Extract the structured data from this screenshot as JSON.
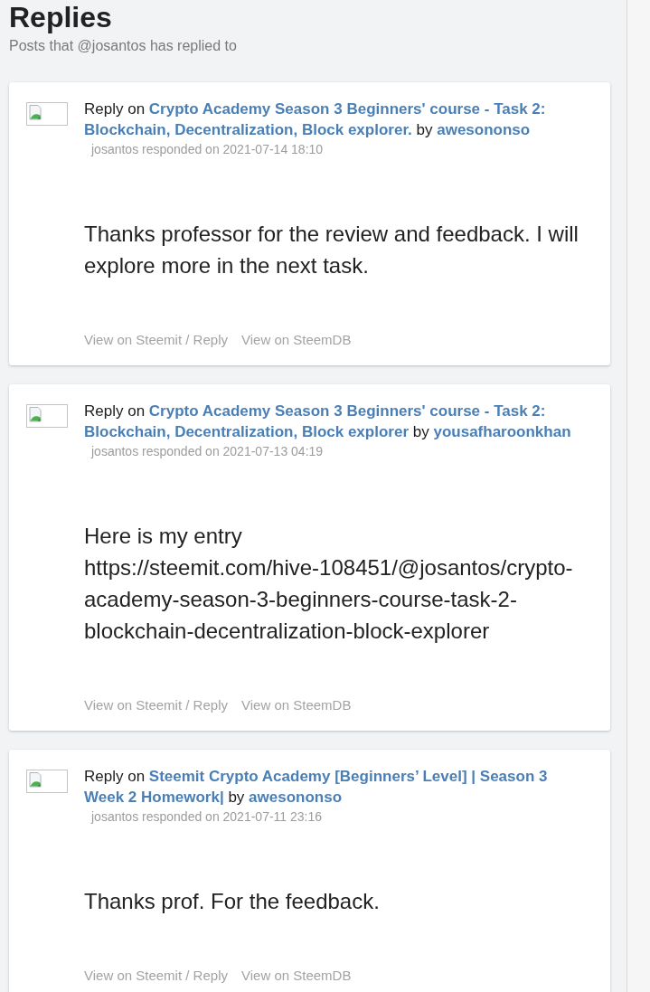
{
  "page": {
    "title": "Replies",
    "subtitle": "Posts that @josantos has replied to"
  },
  "replies": [
    {
      "lead": "Reply on",
      "post_title": [
        "Crypto Academy Season 3 Beginners' course - Task 2:",
        "Blockchain, Decentralization, Block explorer."
      ],
      "by": "by",
      "author": "awesononso",
      "meta": "josantos responded on 2021-07-14 18:10",
      "body": [
        "Thanks professor for the review and feedback. I will explore more in the next task."
      ],
      "links": [
        "View on Steemit / Reply",
        "View on SteemDB"
      ]
    },
    {
      "lead": "Reply on",
      "post_title": [
        "Crypto Academy Season 3 Beginners' course - Task 2:",
        "Blockchain, Decentralization, Block explorer"
      ],
      "by": "by",
      "author": "yousafharoonkhan",
      "meta": "josantos responded on 2021-07-13 04:19",
      "body": [
        "Here is my entry",
        "https://steemit.com/hive-108451/@josantos/crypto-academy-season-3-beginners-course-task-2-blockchain-decentralization-block-explorer"
      ],
      "links": [
        "View on Steemit / Reply",
        "View on SteemDB"
      ]
    },
    {
      "lead": "Reply on",
      "post_title": [
        "Steemit Crypto Academy [Beginners’ Level] | Season 3",
        "Week 2 Homework|"
      ],
      "by": "by",
      "author": "awesononso",
      "meta": "josantos responded on 2021-07-11 23:16",
      "body": [
        "Thanks prof. For the feedback."
      ],
      "links": [
        "View on Steemit / Reply",
        "View on SteemDB"
      ]
    }
  ]
}
